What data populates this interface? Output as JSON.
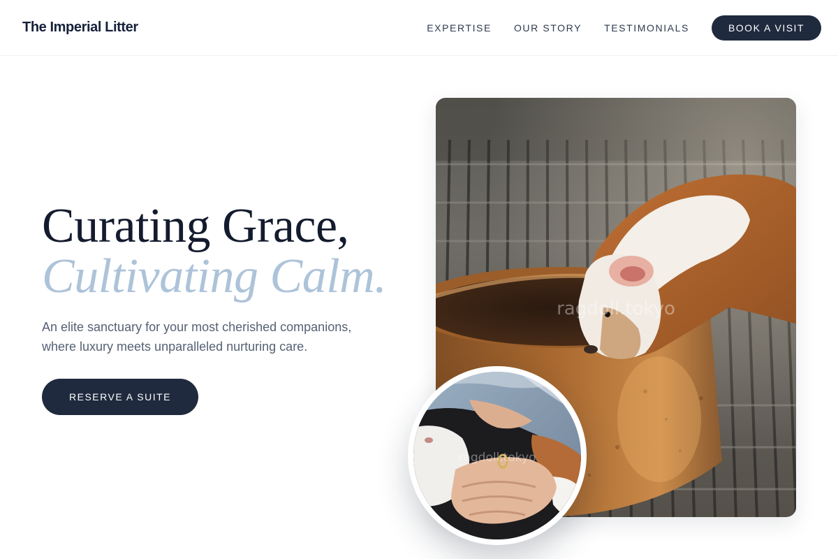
{
  "header": {
    "brand": "The Imperial Litter",
    "nav": [
      {
        "label": "EXPERTISE"
      },
      {
        "label": "OUR STORY"
      },
      {
        "label": "TESTIMONIALS"
      }
    ],
    "cta_label": "BOOK A VISIT"
  },
  "hero": {
    "headline_line1": "Curating Grace,",
    "headline_line2": "Cultivating Calm.",
    "subtext": "An elite sanctuary for your most cherished companions, where luxury meets unparalleled nurturing care.",
    "cta_label": "RESERVE A SUITE"
  },
  "images": {
    "main_photo": {
      "subject": "guinea pig drinking from a ceramic bowl",
      "watermark": "ragdoll.tokyo"
    },
    "inset_photo": {
      "subject": "hands petting a calico cat",
      "watermark": "ragdoll.tokyo"
    }
  },
  "colors": {
    "primary_dark": "#1f2a3e",
    "headline": "#141b2e",
    "headline_accent": "#adc3d9",
    "body_text": "#556174",
    "background": "#ffffff"
  }
}
